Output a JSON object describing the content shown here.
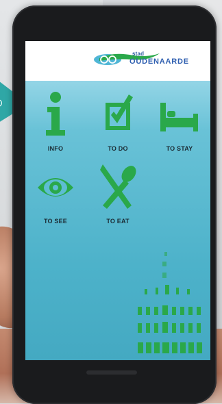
{
  "app": {
    "logo": {
      "brand_small": "stad",
      "brand_name": "OUDENAARDE"
    },
    "menu": [
      {
        "id": "info",
        "label": "INFO",
        "icon": "info-icon"
      },
      {
        "id": "todo",
        "label": "TO DO",
        "icon": "checkbox-icon"
      },
      {
        "id": "stay",
        "label": "TO STAY",
        "icon": "bed-icon"
      },
      {
        "id": "see",
        "label": "TO SEE",
        "icon": "eye-icon"
      },
      {
        "id": "eat",
        "label": "TO EAT",
        "icon": "cutlery-icon"
      }
    ]
  },
  "colors": {
    "icon_green": "#2aa84a",
    "screen_top": "#b6e4f2",
    "screen_bottom": "#44a9c2",
    "label_dark": "#1b2a33",
    "logo_blue": "#2f5fb0"
  }
}
